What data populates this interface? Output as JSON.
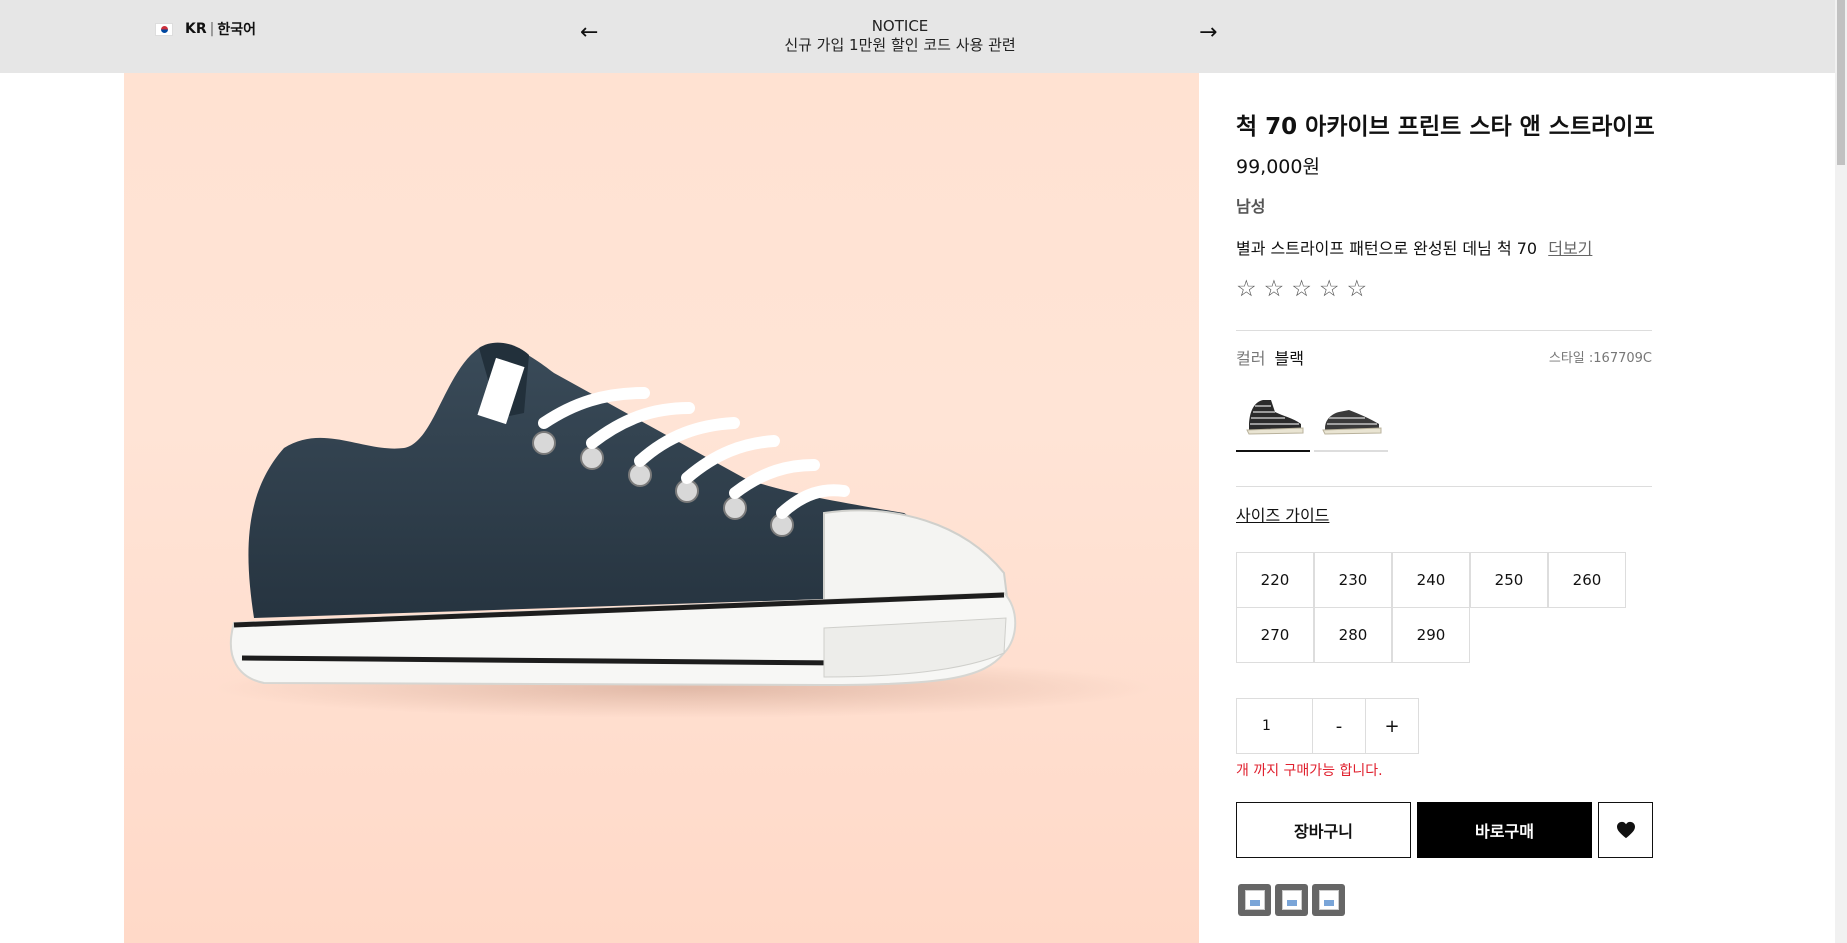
{
  "topbar": {
    "locale_code": "KR",
    "locale_sep": "|",
    "locale_lang": "한국어",
    "notice_title": "NOTICE",
    "notice_text": "신규 가입 1만원 할인 코드 사용 관련",
    "prev_icon": "←",
    "next_icon": "→"
  },
  "product": {
    "title": "척 70 아카이브 프린트 스타 앤 스트라이프",
    "price": "99,000원",
    "gender": "남성",
    "description": "별과 스트라이프 패턴으로 완성된 데님 척 70",
    "more_link": "더보기",
    "rating_stars": 5,
    "rating_value": 0,
    "color_label": "컬러",
    "color_value": "블랙",
    "style_code": "스타일 :167709C",
    "swatches": [
      "black-high",
      "black-low"
    ],
    "size_guide": "사이즈 가이드",
    "sizes": [
      "220",
      "230",
      "240",
      "250",
      "260",
      "270",
      "280",
      "290"
    ],
    "quantity": "1",
    "minus_label": "-",
    "plus_label": "+",
    "limit_text": "개 까지 구매가능 합니다.",
    "cart_label": "장바구니",
    "buy_label": "바로구매"
  },
  "colors": {
    "topbar_bg": "#e6e6e6",
    "image_bg": "#ffe2d2",
    "shoe_canvas": "#2f3f4c",
    "warning": "#e0202e",
    "buy_bg": "#000000"
  },
  "icons": {
    "flag": "kr-flag-icon",
    "prev": "arrow-left-icon",
    "next": "arrow-right-icon",
    "star": "star-outline-icon",
    "wish": "heart-icon",
    "share": [
      "share-broken-image-icon",
      "share-broken-image-icon",
      "share-broken-image-icon"
    ]
  }
}
